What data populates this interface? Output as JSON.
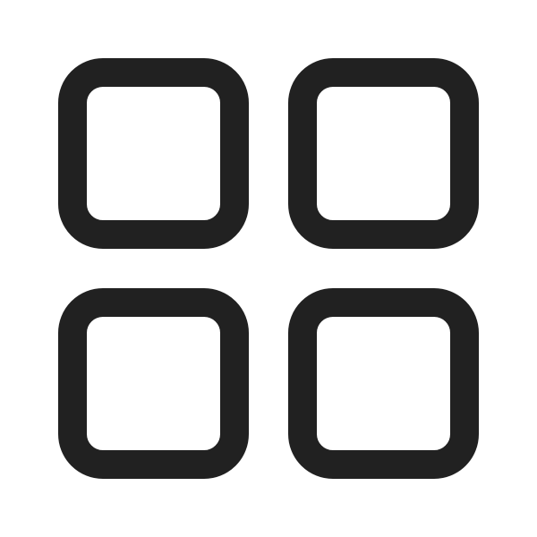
{
  "icon": {
    "name": "app-grid-icon",
    "stroke_color": "#212121",
    "background_color": "#ffffff"
  }
}
